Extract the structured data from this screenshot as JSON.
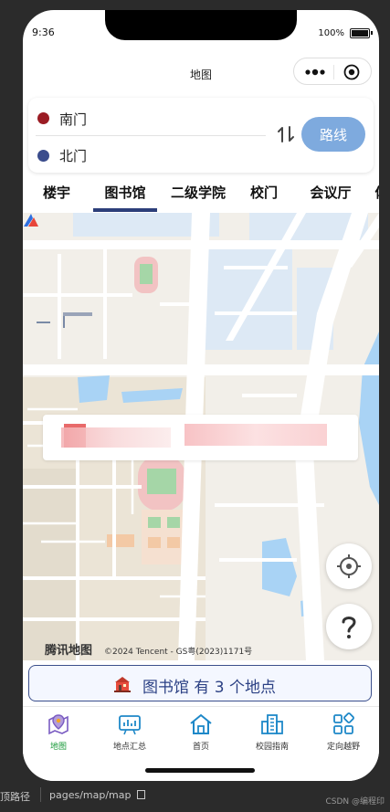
{
  "status_bar": {
    "time": "9:36",
    "battery": "100%"
  },
  "nav": {
    "title": "地图"
  },
  "route": {
    "start": "南门",
    "end": "北门",
    "button_label": "路线"
  },
  "tabs": [
    {
      "label": "楼宇",
      "active": false
    },
    {
      "label": "图书馆",
      "active": true
    },
    {
      "label": "二级学院",
      "active": false
    },
    {
      "label": "校门",
      "active": false
    },
    {
      "label": "会议厅",
      "active": false
    },
    {
      "label": "体",
      "active": false
    }
  ],
  "map": {
    "logo_text": "腾讯地图",
    "copyright": "©2024 Tencent - GS粤(2023)1171号"
  },
  "count_bar": {
    "text": "图书馆 有 3 个地点"
  },
  "bottom_nav": [
    {
      "label": "地图",
      "icon": "map-pin-icon",
      "active": true
    },
    {
      "label": "地点汇总",
      "icon": "chart-board-icon",
      "active": false
    },
    {
      "label": "首页",
      "icon": "home-icon",
      "active": false
    },
    {
      "label": "校园指南",
      "icon": "building-icon",
      "active": false
    },
    {
      "label": "定向越野",
      "icon": "grid-icon",
      "active": false
    }
  ],
  "devtool": {
    "left": "顶路径",
    "path": "pages/map/map",
    "credit": "CSDN @编程印"
  },
  "colors": {
    "accent": "#2c3e7a",
    "route_button": "#7eaade",
    "active_tab_label": "#1a9a3a"
  }
}
